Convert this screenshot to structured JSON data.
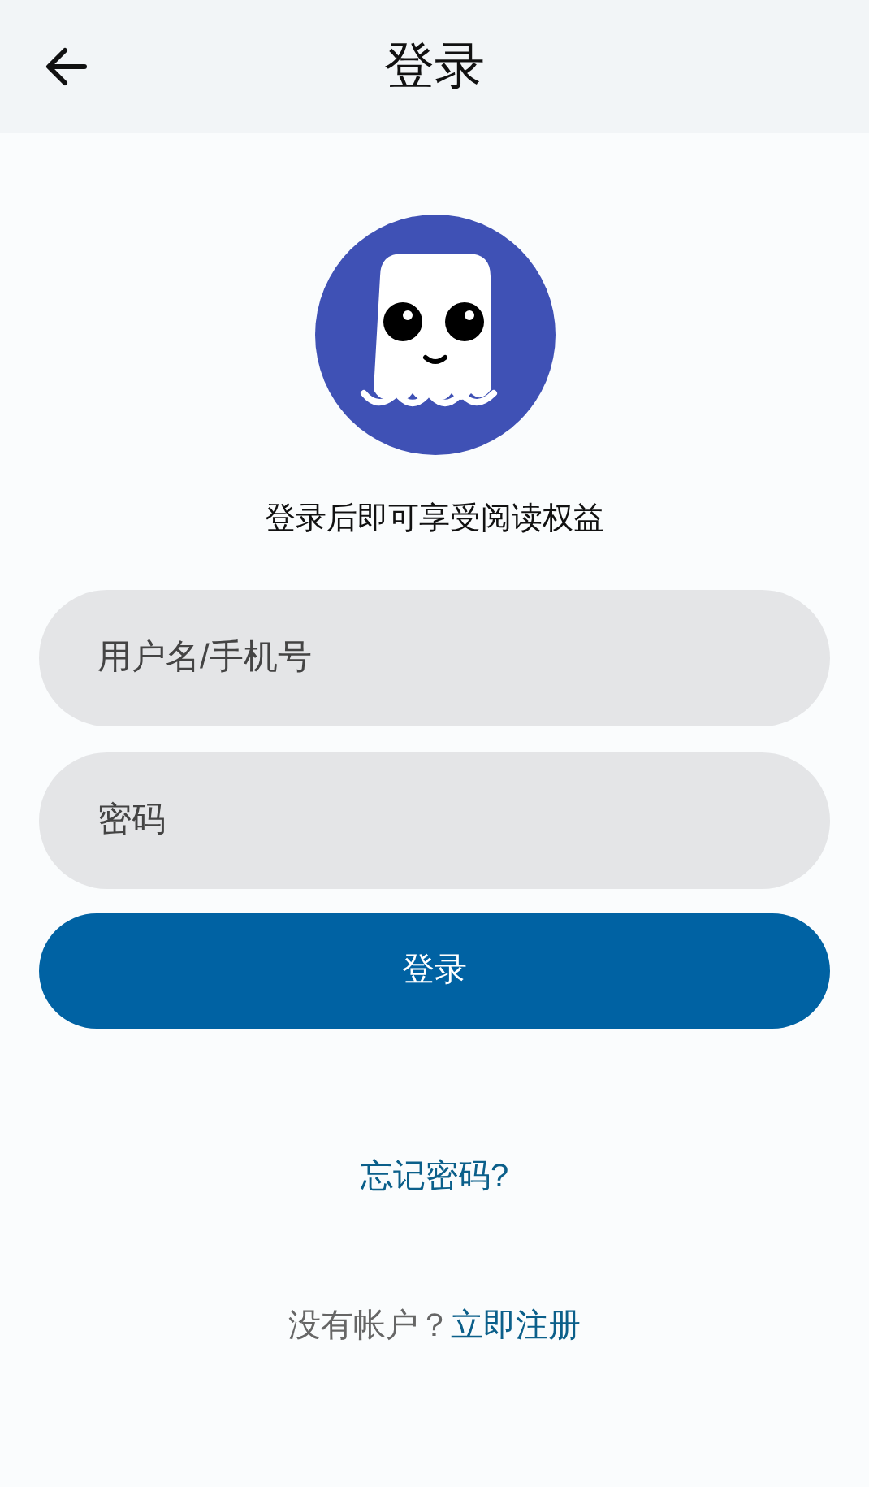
{
  "header": {
    "title": "登录"
  },
  "tagline": "登录后即可享受阅读权益",
  "fields": [
    {
      "placeholder": "用户名/手机号"
    },
    {
      "placeholder": "密码"
    }
  ],
  "login_button": "登录",
  "forgot_link": "忘记密码?",
  "signup": {
    "prompt": "没有帐户？",
    "link": "立即注册"
  }
}
